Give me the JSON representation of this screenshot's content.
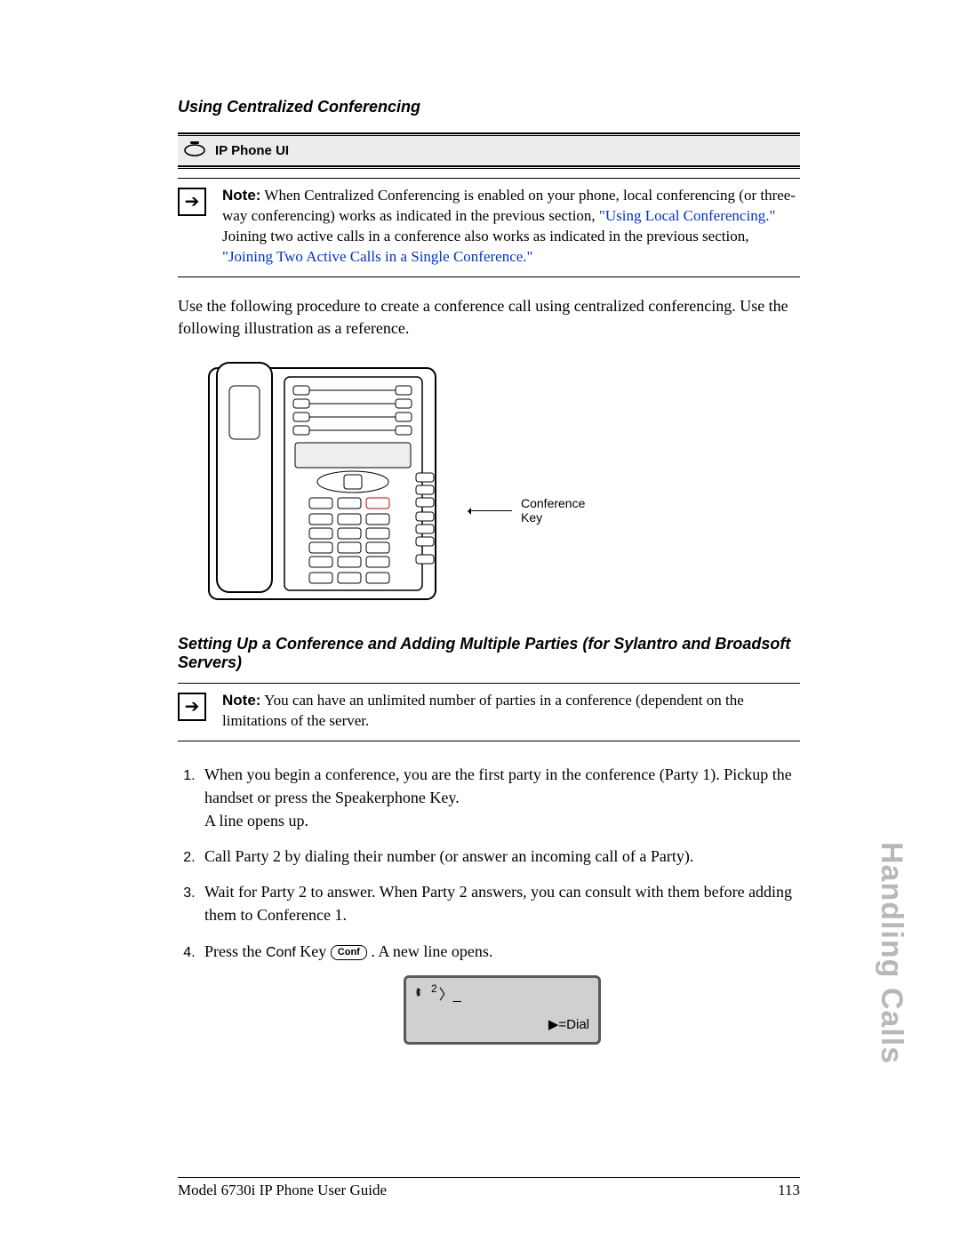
{
  "headings": {
    "h1": "Using Centralized Conferencing",
    "ip_bar": "IP Phone UI",
    "h2": "Setting Up a Conference and Adding Multiple Parties (for Sylantro and Broadsoft Servers)"
  },
  "note1": {
    "label": "Note:",
    "text_a": " When Centralized Conferencing is enabled on your phone, local conferencing (or three-way conferencing) works as indicated in the previous section, ",
    "link1": "\"Using Local Conferencing.\"",
    "text_b": " Joining two active calls in a conference also works as indicated in the previous section, ",
    "link2": "\"Joining Two Active Calls in a Single Conference.\""
  },
  "para1": "Use the following procedure to create a conference call using centralized conferencing. Use the following illustration as a reference.",
  "callout": {
    "line1": "Conference",
    "line2": "Key"
  },
  "note2": {
    "label": "Note:",
    "text": " You can have an unlimited number of parties in a conference (dependent on the limitations of the server."
  },
  "steps": {
    "s1a": "When you begin a conference, you are the first party in the conference (Party 1). Pickup the handset or press the Speakerphone Key.",
    "s1b": "A line opens up.",
    "s2": "Call Party 2 by dialing their number (or answer an incoming call of a Party).",
    "s3": "Wait for Party 2 to answer. When Party 2 answers, you can consult with them before adding them to Conference 1.",
    "s4_a": "Press the ",
    "s4_key": "Conf",
    "s4_b": " Key ",
    "s4_btn": "Conf",
    "s4_c": " . A new line opens.",
    "lcd_num": "2",
    "lcd_dial": "▶=Dial"
  },
  "sidetab": "Handling Calls",
  "footer": {
    "left": "Model 6730i IP Phone User Guide",
    "right": "113"
  }
}
